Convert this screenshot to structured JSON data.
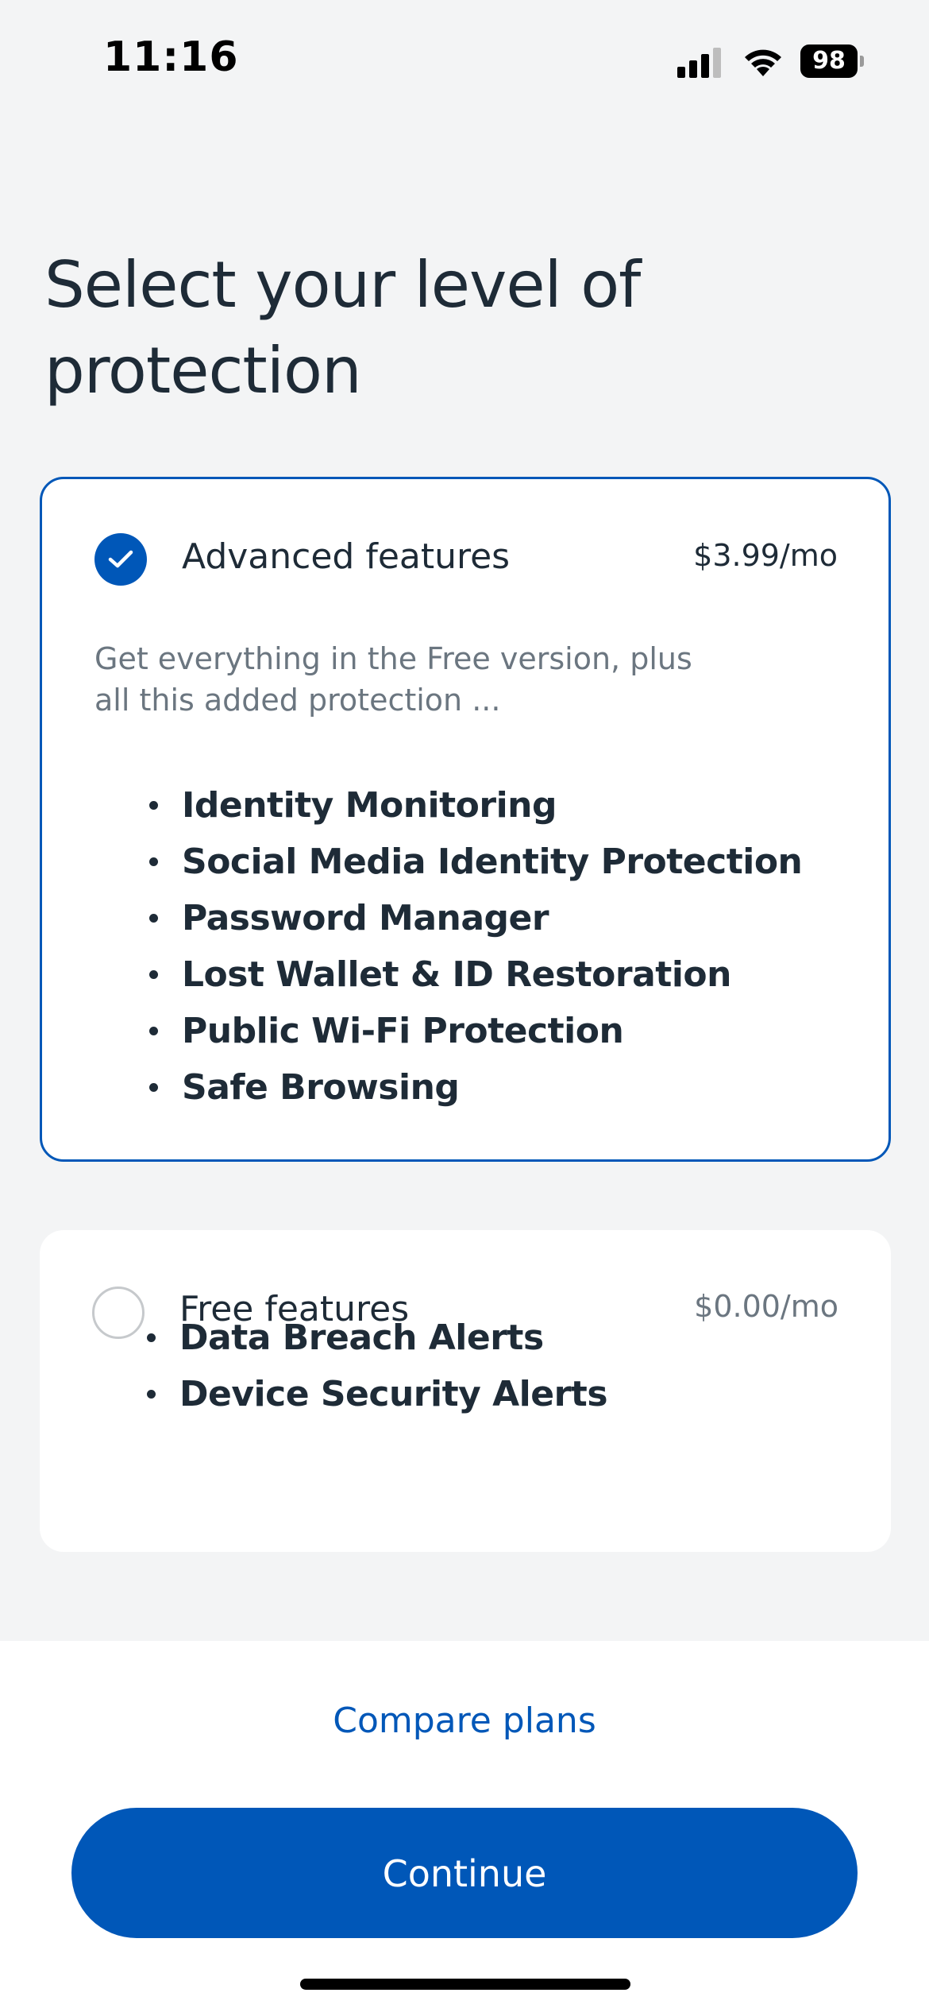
{
  "status_bar": {
    "time": "11:16",
    "battery": "98",
    "icons": [
      "signal-icon",
      "wifi-icon",
      "battery-icon"
    ]
  },
  "page": {
    "title": "Select your level of protection"
  },
  "plans": [
    {
      "name": "Advanced features",
      "price": "$3.99/mo",
      "selected": true,
      "description": "Get everything in the Free version, plus all this added protection ...",
      "features": [
        "Identity Monitoring",
        "Social Media Identity Protection",
        "Password Manager",
        "Lost Wallet & ID Restoration",
        "Public Wi-Fi Protection",
        "Safe Browsing"
      ]
    },
    {
      "name": "Free features",
      "price": "$0.00/mo",
      "selected": false,
      "features": [
        "Data Breach Alerts",
        "Device Security Alerts"
      ]
    }
  ],
  "footer": {
    "compare_label": "Compare plans",
    "continue_label": "Continue"
  },
  "colors": {
    "accent": "#0057b8",
    "background": "#f3f4f5",
    "text": "#1e2b37",
    "muted": "#6b7680"
  }
}
